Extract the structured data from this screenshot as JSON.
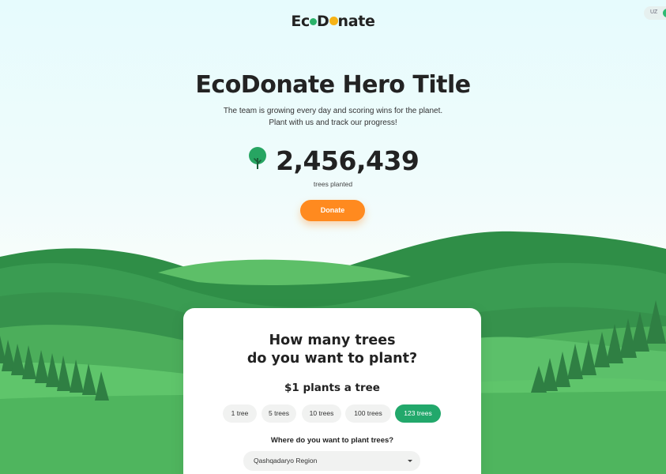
{
  "header": {
    "logo_part1": "Ec",
    "logo_part2": "D",
    "logo_part3": "nate",
    "lang": "UZ"
  },
  "hero": {
    "title": "EcoDonate Hero Title",
    "subtitle_line1": "The team is growing every day and scoring wins for the planet.",
    "subtitle_line2": "Plant with us and track our progress!",
    "counter": "2,456,439",
    "counter_label": "trees planted",
    "donate_label": "Donate"
  },
  "card": {
    "title_line1": "How many trees",
    "title_line2": "do you want to plant?",
    "price": "$1 plants a tree",
    "options": [
      "1 tree",
      "5 trees",
      "10 trees",
      "100 trees",
      "123 trees"
    ],
    "selected_option": "123 trees",
    "where_label": "Where do you want to plant trees?",
    "region": "Qashqadaryo Region"
  },
  "colors": {
    "accent_orange": "#ff8a1f",
    "accent_green": "#22a86b",
    "tree_icon": "tree-icon"
  }
}
